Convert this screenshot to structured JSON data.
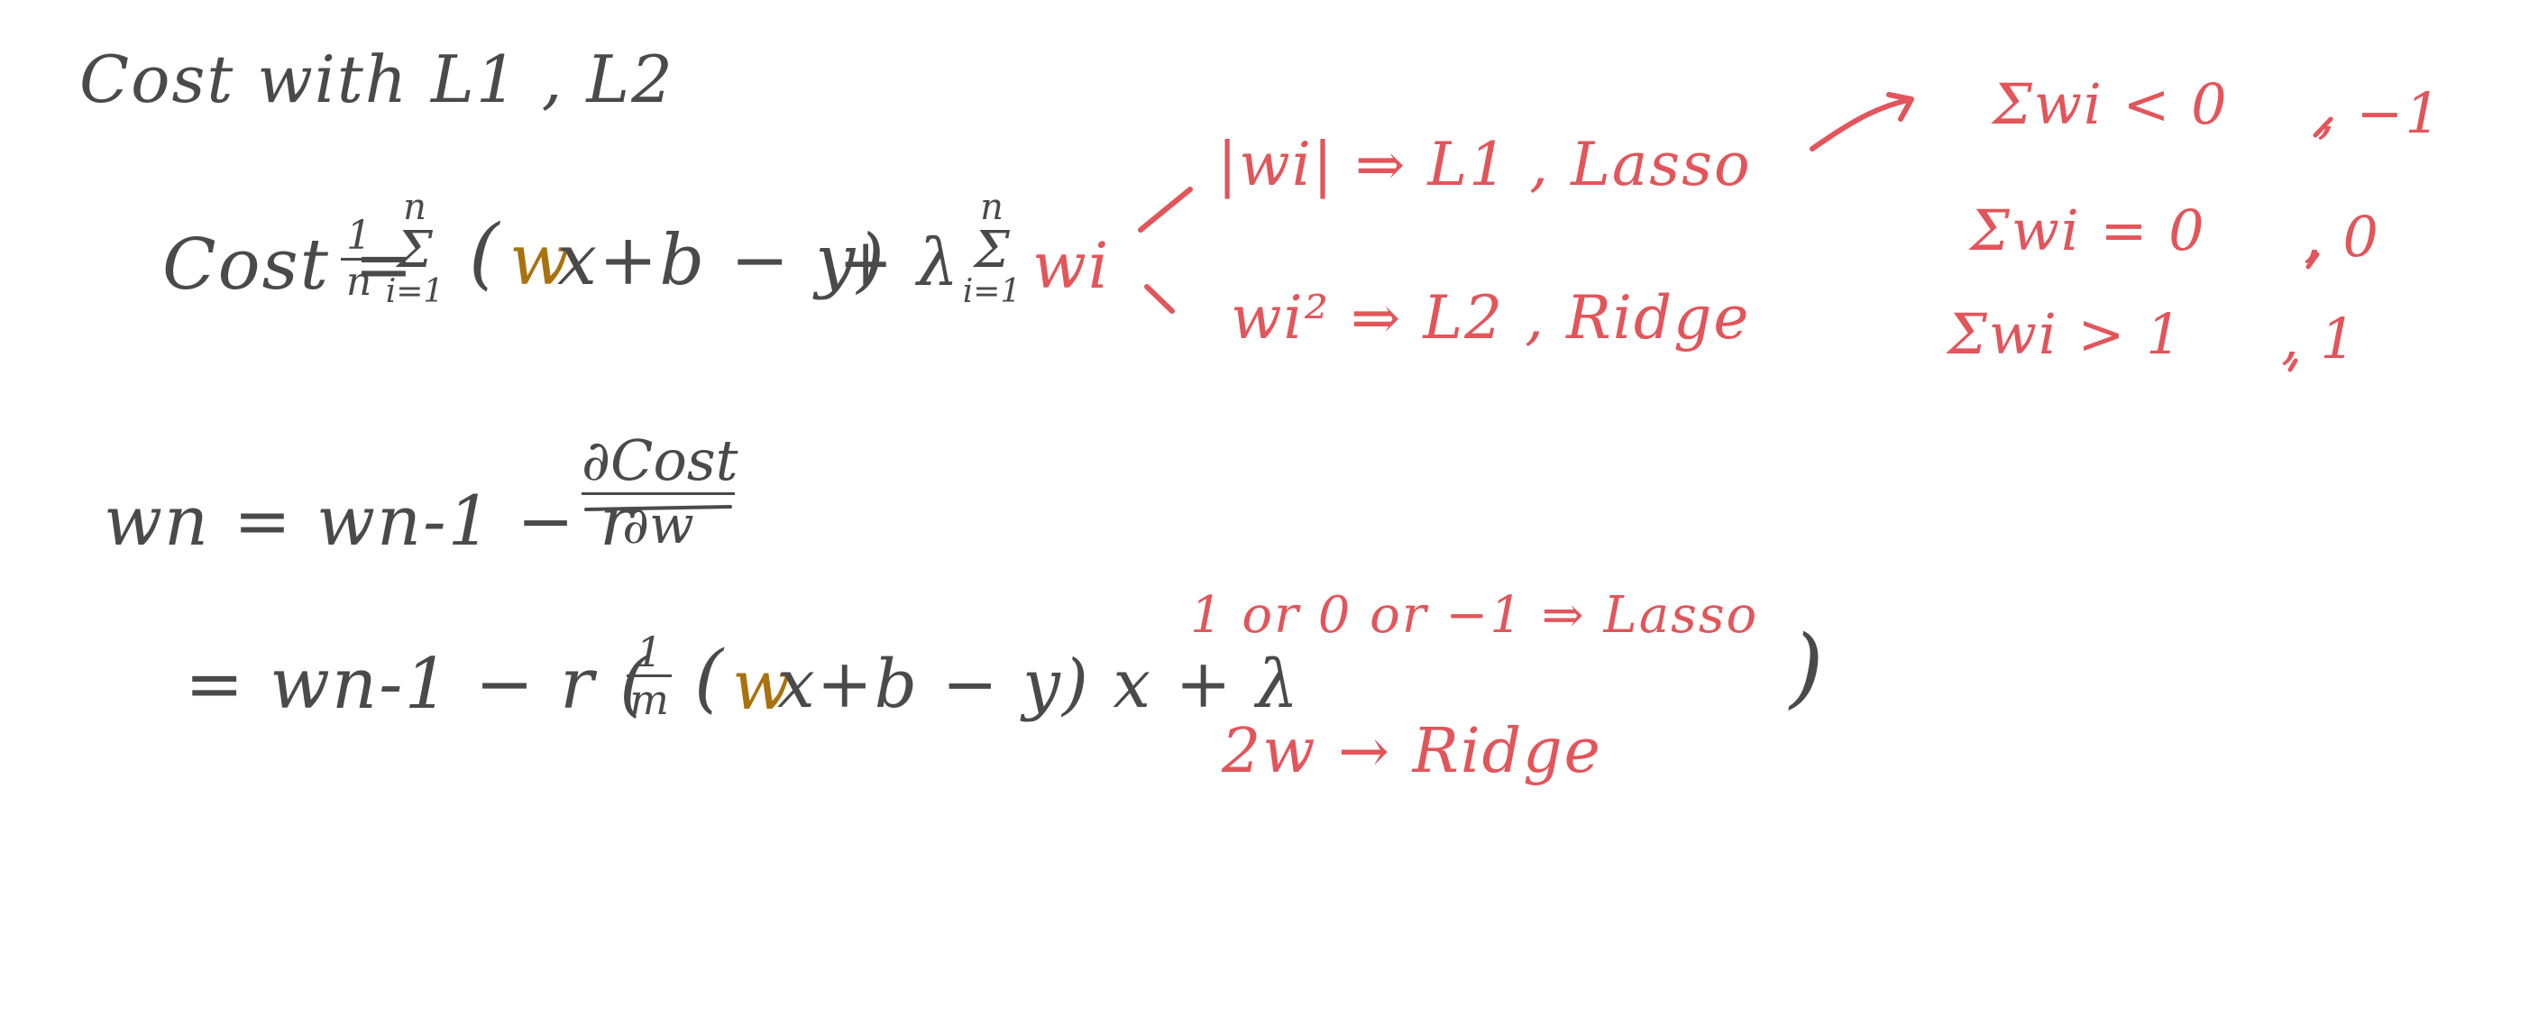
{
  "colors": {
    "ink_dark": "#4a4a4a",
    "ink_red": "#e2555a",
    "ink_gold": "#a8720f"
  },
  "title": "Cost with L1 , L2",
  "cost_eq": {
    "lhs": "Cost =",
    "frac_num": "1",
    "frac_den": "n",
    "sum_upper": "n",
    "sum_symbol": "Σ",
    "sum_lower": "i=1",
    "open": "(",
    "w": "w",
    "rest": "x+b − y)",
    "plus_lambda": "+ λ",
    "sum2_upper": "n",
    "sum2_symbol": "Σ",
    "sum2_lower": "i=1",
    "wi": "wi"
  },
  "branches": {
    "lasso": "|wi| ⇒ L1 , Lasso",
    "ridge": "wi² ⇒ L2 , Ridge"
  },
  "sign_cases": [
    {
      "cond": "Σwi < 0",
      "val": ", −1"
    },
    {
      "cond": "Σwi = 0",
      "val": ", 0"
    },
    {
      "cond": "Σwi > 1",
      "val": ", 1"
    }
  ],
  "update_eq": {
    "lhs": "wn = wn-1 − r",
    "deriv_num": "∂Cost",
    "deriv_den": "∂w"
  },
  "update_eq2": {
    "prefix": "= wn-1 − r (",
    "frac_num": "1",
    "frac_den": "m",
    "open": "(",
    "w": "w",
    "rest": "x+b − y) x + λ",
    "lasso_term": "1 or 0 or −1 ⇒ Lasso",
    "ridge_term": "2w → Ridge",
    "close": ")"
  }
}
